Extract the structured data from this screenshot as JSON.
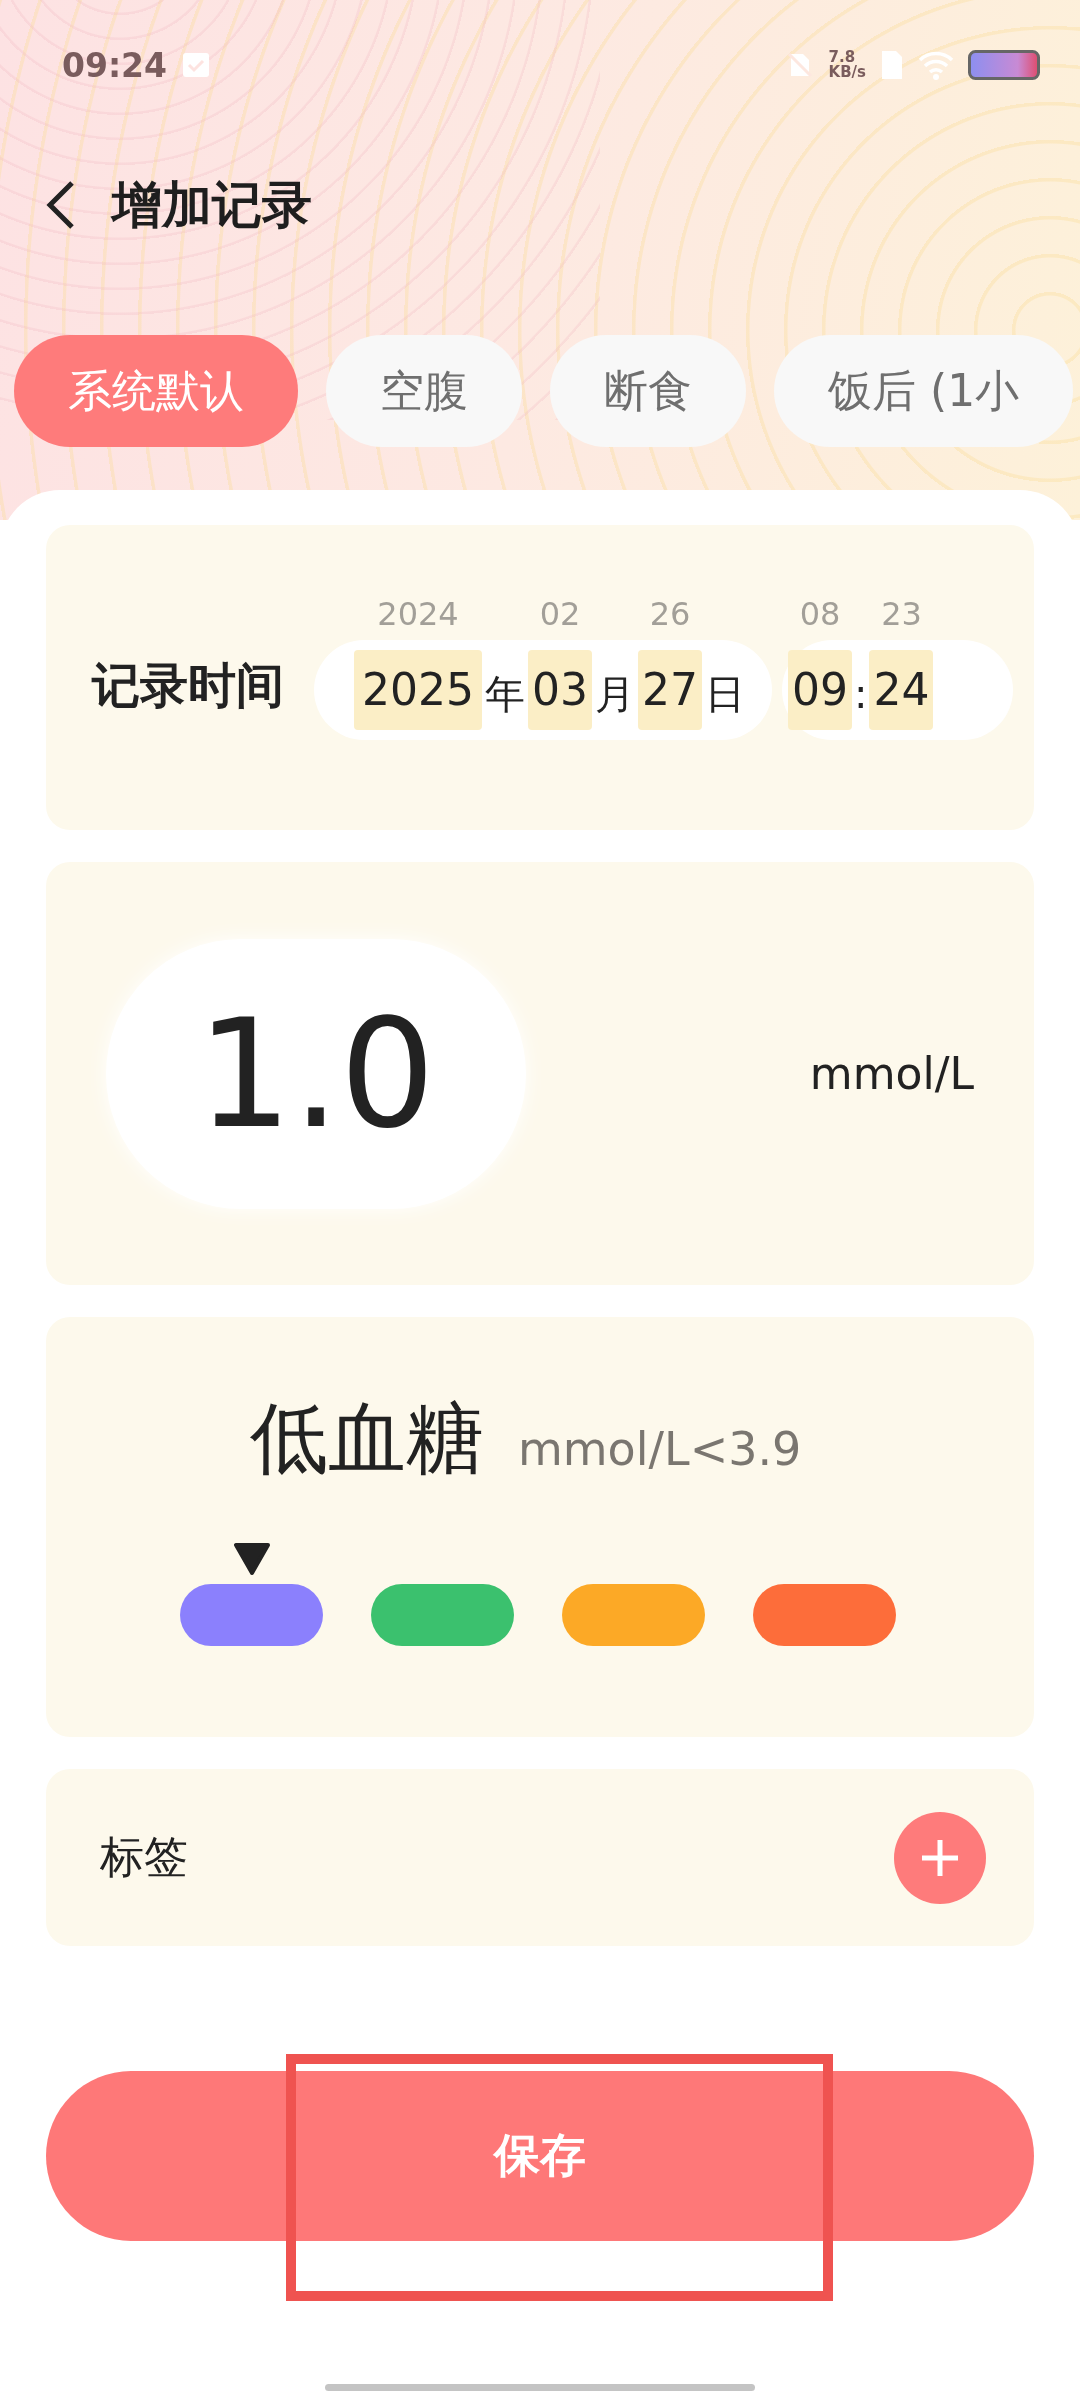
{
  "status_bar": {
    "time": "09:24",
    "network_speed": "7.8",
    "network_unit": "KB/s"
  },
  "header": {
    "title": "增加记录"
  },
  "tabs": [
    {
      "label": "系统默认",
      "selected": true
    },
    {
      "label": "空腹",
      "selected": false
    },
    {
      "label": "断食",
      "selected": false
    },
    {
      "label": "饭后 (1小",
      "selected": false
    }
  ],
  "record_time": {
    "label": "记录时间",
    "date_fields": [
      {
        "previous": "2024",
        "value": "2025",
        "suffix": "年"
      },
      {
        "previous": "02",
        "value": "03",
        "suffix": "月"
      },
      {
        "previous": "26",
        "value": "27",
        "suffix": "日"
      }
    ],
    "time_fields": [
      {
        "previous": "08",
        "value": "09"
      },
      {
        "previous": "23",
        "value": "24"
      }
    ],
    "time_separator": ":"
  },
  "reading": {
    "value": "1.0",
    "unit": "mmol/L"
  },
  "range": {
    "name": "低血糖",
    "criterion": "mmol/L<3.9",
    "levels": [
      {
        "color": "#8b80fd",
        "selected": true
      },
      {
        "color": "#3bc16e",
        "selected": false
      },
      {
        "color": "#fca926",
        "selected": false
      },
      {
        "color": "#fd6d3a",
        "selected": false
      }
    ]
  },
  "tags": {
    "label": "标签"
  },
  "save_button": {
    "label": "保存"
  },
  "annotation": {
    "kind": "rectangle"
  }
}
